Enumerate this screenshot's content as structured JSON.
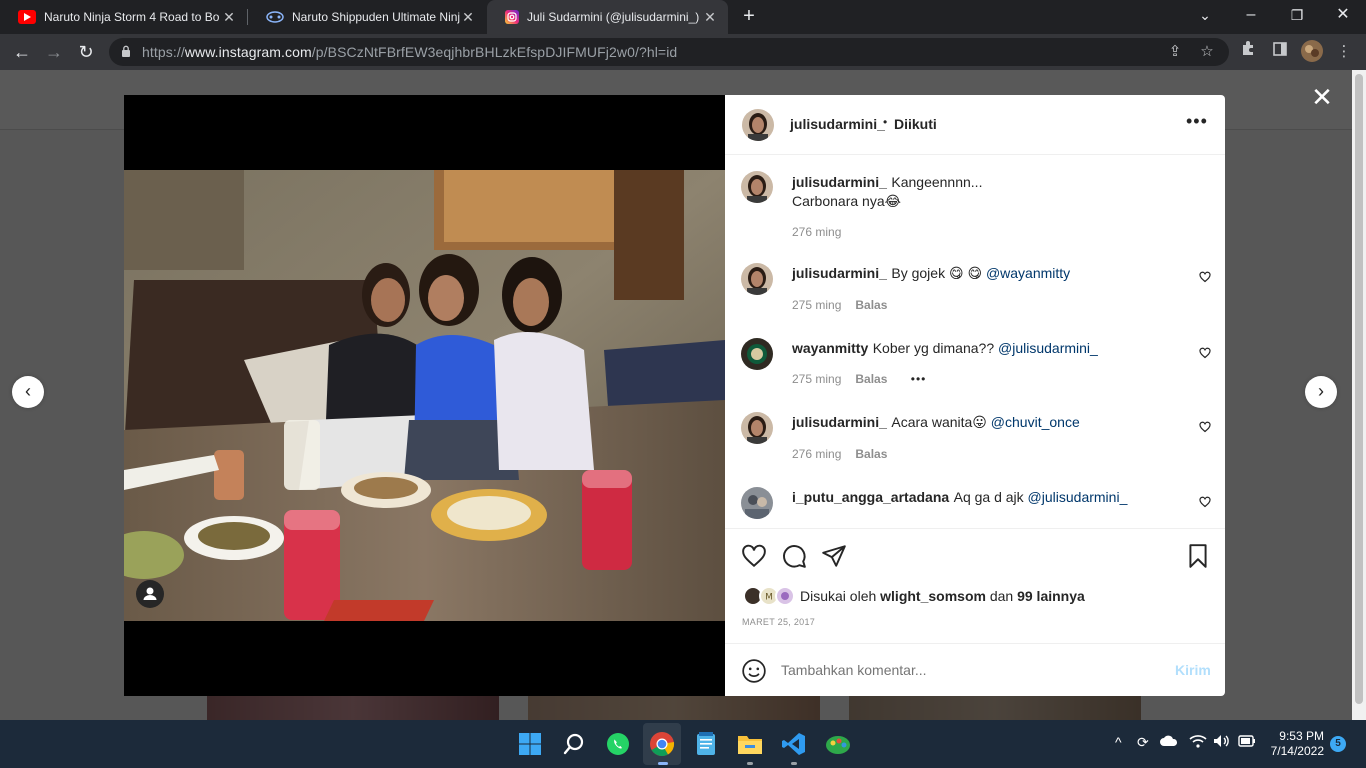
{
  "browser": {
    "tabs": [
      {
        "title": "Naruto Ninja Storm 4 Road to Bo",
        "icon": "youtube-icon",
        "active": false
      },
      {
        "title": "Naruto Shippuden Ultimate Ninja",
        "icon": "game-controller-icon",
        "active": false
      },
      {
        "title": "Juli Sudarmini (@julisudarmini_) •",
        "icon": "instagram-icon",
        "active": true
      }
    ],
    "url_prefix": "https://",
    "url_host": "www.instagram.com",
    "url_path": "/p/BSCzNtFBrfEW3eqjhbrBHLzkEfspDJIFMUFj2w0/?hl=id"
  },
  "post": {
    "author": "julisudarmini_",
    "follow_sep": "•",
    "follow_state": "Diikuti",
    "caption_line1": "Kangeennnn...",
    "caption_line2": "Carbonara nya😂",
    "caption_time": "276 ming",
    "reply_label": "Balas",
    "comments": [
      {
        "user": "julisudarmini_",
        "text": "By gojek 😋 😋 ",
        "mention": "@wayanmitty",
        "time": "275 ming"
      },
      {
        "user": "wayanmitty",
        "text": "Kober yg dimana?? ",
        "mention": "@julisudarmini_",
        "time": "275 ming",
        "more": "•••"
      },
      {
        "user": "julisudarmini_",
        "text": "Acara wanita😛 ",
        "mention": "@chuvit_once",
        "time": "276 ming"
      },
      {
        "user": "i_putu_angga_artadana",
        "text": "Aq ga d ajk ",
        "mention": "@julisudarmini_"
      }
    ],
    "likes_prefix": "Disukai oleh ",
    "likes_user": "wlight_somsom",
    "likes_mid": " dan ",
    "likes_others": "99 lainnya",
    "date": "MARET 25, 2017",
    "add_comment_placeholder": "Tambahkan komentar...",
    "post_button": "Kirim"
  },
  "taskbar": {
    "time": "9:53 PM",
    "date": "7/14/2022",
    "notification_count": "5"
  },
  "colors": {
    "accent_link": "#00376b",
    "muted": "#8e8e8e",
    "post_button_disabled": "#b2dffc"
  }
}
